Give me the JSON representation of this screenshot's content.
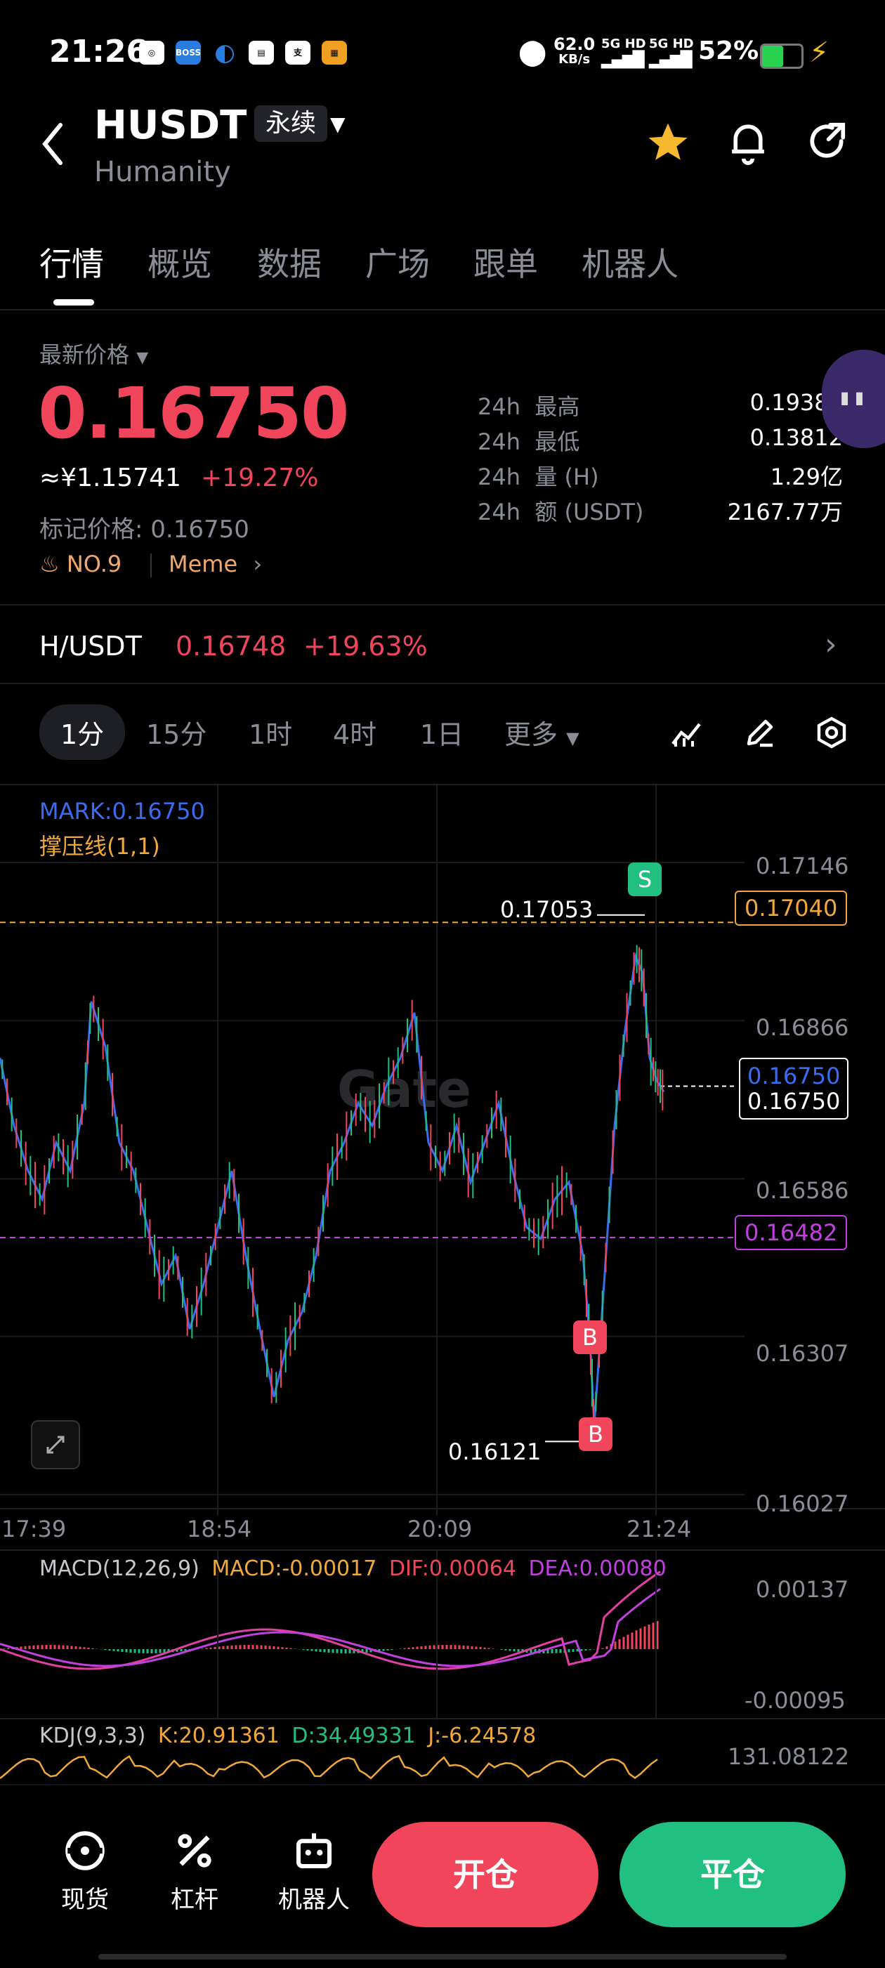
{
  "status_bar": {
    "time": "21:26",
    "speed": "62.0",
    "speed_unit": "KB/s",
    "net1": "5G HD",
    "net2": "5G HD",
    "battery": "52%"
  },
  "header": {
    "symbol": "HUSDT",
    "contract_type": "永续",
    "name": "Humanity"
  },
  "tabs": [
    "行情",
    "概览",
    "数据",
    "广场",
    "跟单",
    "机器人"
  ],
  "price": {
    "label": "最新价格",
    "last": "0.16750",
    "cny": "≈¥1.15741",
    "change_pct": "+19.27%",
    "mark_label": "标记价格: 0.16750",
    "rank": "NO.9",
    "tag": "Meme"
  },
  "stats_24h": [
    {
      "prefix": "24h",
      "label": "最高",
      "value": "0.19388"
    },
    {
      "prefix": "24h",
      "label": "最低",
      "value": "0.13812"
    },
    {
      "prefix": "24h",
      "label": "量 (H)",
      "value": "1.29亿"
    },
    {
      "prefix": "24h",
      "label": "额 (USDT)",
      "value": "2167.77万"
    }
  ],
  "spot_pair": {
    "pair": "H/USDT",
    "price": "0.16748",
    "change": "+19.63%"
  },
  "intervals": [
    "1分",
    "15分",
    "1时",
    "4时",
    "1日",
    "更多"
  ],
  "chart": {
    "mark_label": "MARK:0.16750",
    "support_label": "撑压线(1,1)",
    "watermark": "Gate",
    "y_ticks": [
      "0.17146",
      "0.16866",
      "0.16586",
      "0.16307",
      "0.16027"
    ],
    "x_ticks": [
      "17:39",
      "18:54",
      "20:09",
      "21:24"
    ],
    "high_marker": "0.17053",
    "low_marker": "0.16121",
    "resistance": "0.17040",
    "support": "0.16482",
    "current_mark": "0.16750",
    "current_last": "0.16750",
    "sell_marker": "S",
    "buy_marker": "B",
    "colors": {
      "up": "#22c080",
      "down": "#f0455a",
      "line": "#3a6cf0",
      "resistance": "#f0a83a",
      "support": "#c040e0"
    }
  },
  "macd": {
    "title": "MACD(12,26,9)",
    "macd": "MACD:-0.00017",
    "dif": "DIF:0.00064",
    "dea": "DEA:0.00080",
    "y_top": "0.00137",
    "y_bottom": "-0.00095"
  },
  "kdj": {
    "title": "KDJ(9,3,3)",
    "k": "K:20.91361",
    "d": "D:34.49331",
    "j": "J:-6.24578",
    "y_top": "131.08122"
  },
  "bottom_nav": {
    "spot": "现货",
    "leverage": "杠杆",
    "robot": "机器人",
    "open": "开仓",
    "close": "平仓"
  }
}
